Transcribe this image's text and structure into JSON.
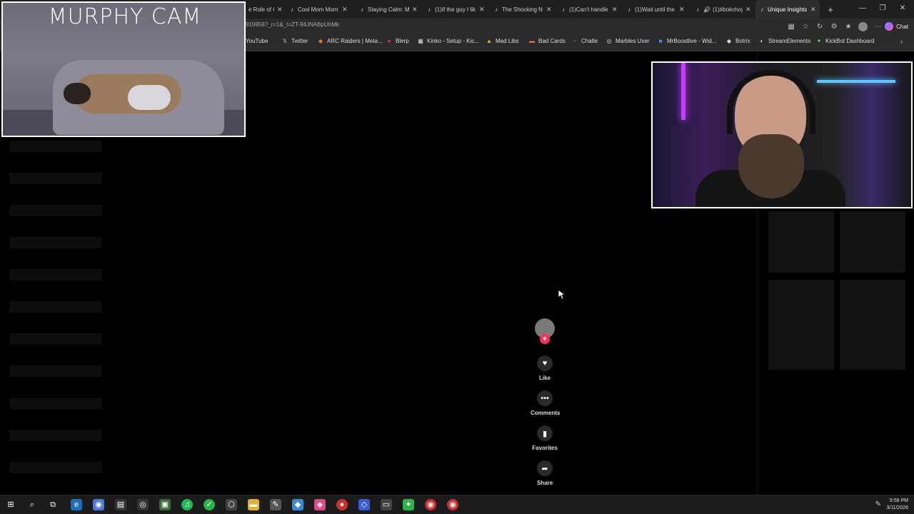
{
  "browser": {
    "tabs": [
      {
        "title": "e Role of Cc",
        "icon": "tiktok-icon",
        "active": false
      },
      {
        "title": "Cool Mom Mom",
        "icon": "tiktok-icon",
        "active": false
      },
      {
        "title": "Staying Calm: My",
        "icon": "tiktok-icon",
        "active": false
      },
      {
        "title": "(1)If the guy I lik",
        "icon": "tiktok-icon",
        "active": false
      },
      {
        "title": "The Shocking N",
        "icon": "tiktok-icon",
        "active": false
      },
      {
        "title": "(1)Can't handle it",
        "icon": "tiktok-icon",
        "active": false
      },
      {
        "title": "(1)Wait until the",
        "icon": "tiktok-icon",
        "active": false
      },
      {
        "title": "(1)#bokchoy",
        "icon": "tiktok-icon",
        "active": false,
        "audio": true
      },
      {
        "title": "Unique Insights o",
        "icon": "tiktok-icon",
        "active": true
      }
    ],
    "new_tab": "+",
    "url": "919956?_r=1&_t=ZT-94JNABpUhMk",
    "copilot_label": "Chat",
    "bookmarks": [
      {
        "label": "YouTube",
        "icon": "youtube-icon"
      },
      {
        "label": "Twitter",
        "icon": "x-icon"
      },
      {
        "label": "ARC Raiders | Meta...",
        "icon": "arc-icon"
      },
      {
        "label": "Blerp",
        "icon": "blerp-icon"
      },
      {
        "label": "Kinko - Setup - Kic...",
        "icon": "grid-icon"
      },
      {
        "label": "Mad Libs",
        "icon": "madlibs-icon"
      },
      {
        "label": "Bad Cards",
        "icon": "cards-icon"
      },
      {
        "label": "Chatle",
        "icon": "chatle-icon"
      },
      {
        "label": "Marbles User",
        "icon": "globe-icon"
      },
      {
        "label": "MrBoostlive - Wid...",
        "icon": "mrboost-icon"
      },
      {
        "label": "Botrix",
        "icon": "botrix-icon"
      },
      {
        "label": "StreamElements",
        "icon": "streamelements-icon"
      },
      {
        "label": "KickBot Dashboard",
        "icon": "kickbot-icon"
      }
    ]
  },
  "overlays": {
    "dog_cam_title": "MURPHY CAM"
  },
  "actions": {
    "follow": "+",
    "like": "Like",
    "comments": "Comments",
    "favorites": "Favorites",
    "share": "Share"
  },
  "taskbar": {
    "time": "9:58 PM",
    "date": "3/11/2026"
  },
  "colors": {
    "follow_accent": "#fe2c55",
    "background": "#000000",
    "browser_chrome": "#2b2b2b"
  }
}
